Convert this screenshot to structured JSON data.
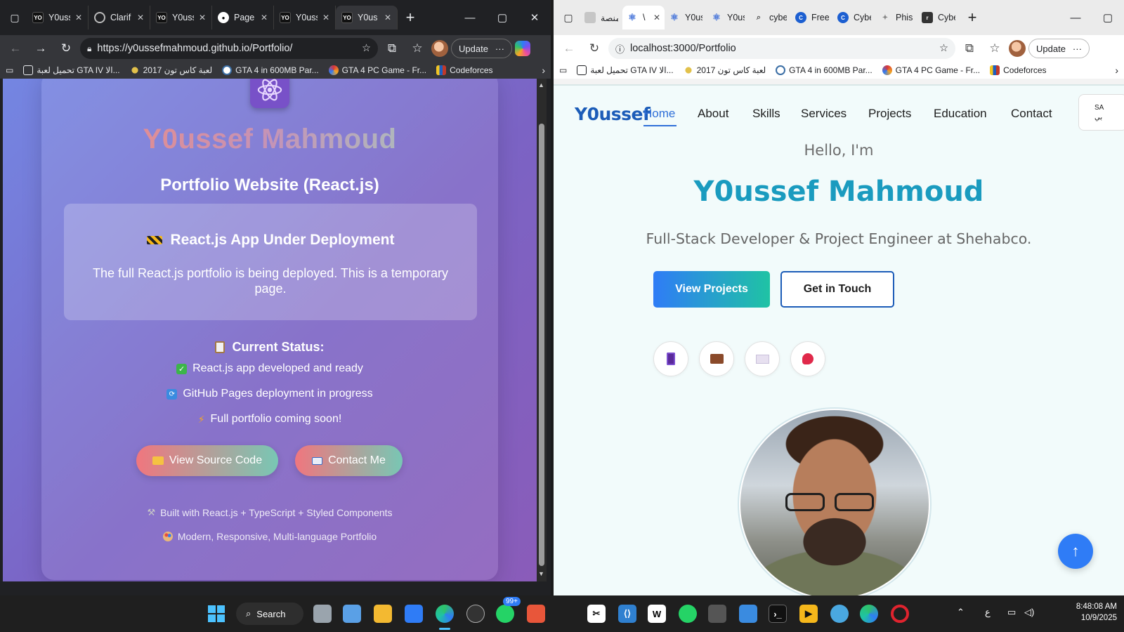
{
  "left_browser": {
    "tabs": [
      {
        "title": "Y0uss",
        "icon": "yo-favicon"
      },
      {
        "title": "Clarif",
        "icon": "clarif-favicon"
      },
      {
        "title": "Y0uss",
        "icon": "yo-favicon"
      },
      {
        "title": "Page",
        "icon": "github-icon"
      },
      {
        "title": "Y0uss",
        "icon": "yo-favicon"
      },
      {
        "title": "Y0us",
        "icon": "yo-favicon",
        "active": true
      }
    ],
    "url": "https://y0ussefmahmoud.github.io/Portfolio/",
    "update_label": "Update",
    "bookmarks": [
      "تحميل لعبة GTA IV الا...",
      "لعبة كاس تون 2017",
      "GTA 4 in 600MB Par...",
      "GTA 4 PC Game - Fr...",
      "Codeforces"
    ]
  },
  "left_page": {
    "name": "Y0ussef Mahmoud",
    "subtitle": "Portfolio Website (React.js)",
    "notice_title": "React.js App Under Deployment",
    "notice_text": "The full React.js portfolio is being deployed. This is a temporary page.",
    "status_title": "Current Status:",
    "status_items": [
      "React.js app developed and ready",
      "GitHub Pages deployment in progress",
      "Full portfolio coming soon!"
    ],
    "btn_source": "View Source Code",
    "btn_contact": "Contact Me",
    "footer_1": "Built with React.js + TypeScript + Styled Components",
    "footer_2": "Modern, Responsive, Multi-language Portfolio"
  },
  "right_browser": {
    "tabs": [
      {
        "title": "منصة",
        "icon": "grid-favicon"
      },
      {
        "title": "\\",
        "icon": "react-favicon",
        "active": true
      },
      {
        "title": "Y0uss",
        "icon": "react-favicon"
      },
      {
        "title": "Y0uss",
        "icon": "react-favicon"
      },
      {
        "title": "cyber",
        "icon": "search-favicon"
      },
      {
        "title": "Free (",
        "icon": "c-favicon"
      },
      {
        "title": "Cyber",
        "icon": "c-favicon"
      },
      {
        "title": "Phish",
        "icon": "phish-favicon"
      },
      {
        "title": "Cybe",
        "icon": "cb-favicon"
      }
    ],
    "url": "localhost:3000/Portfolio",
    "update_label": "Update",
    "bookmarks": [
      "تحميل لعبة GTA IV الا...",
      "لعبة كاس تون 2017",
      "GTA 4 in 600MB Par...",
      "GTA 4 PC Game - Fr...",
      "Codeforces"
    ]
  },
  "right_page": {
    "logo": "Y0ussef",
    "nav": [
      "Home",
      "About",
      "Skills",
      "Services",
      "Projects",
      "Education",
      "Contact"
    ],
    "lang_line_1": "SA",
    "lang_line_2": "بي",
    "hello": "Hello, I'm",
    "name": "Y0ussef Mahmoud",
    "tagline": "Full-Stack Developer & Project Engineer at Shehabco.",
    "btn_projects": "View Projects",
    "btn_touch": "Get in Touch",
    "social_icons": [
      "phone-icon",
      "briefcase-icon",
      "envelope-icon",
      "pin-icon"
    ]
  },
  "taskbar": {
    "search_label": "Search",
    "whatsapp_badge": "99+",
    "lang_indicator": "ع",
    "time": "8:48:08 AM",
    "date": "10/9/2025"
  }
}
